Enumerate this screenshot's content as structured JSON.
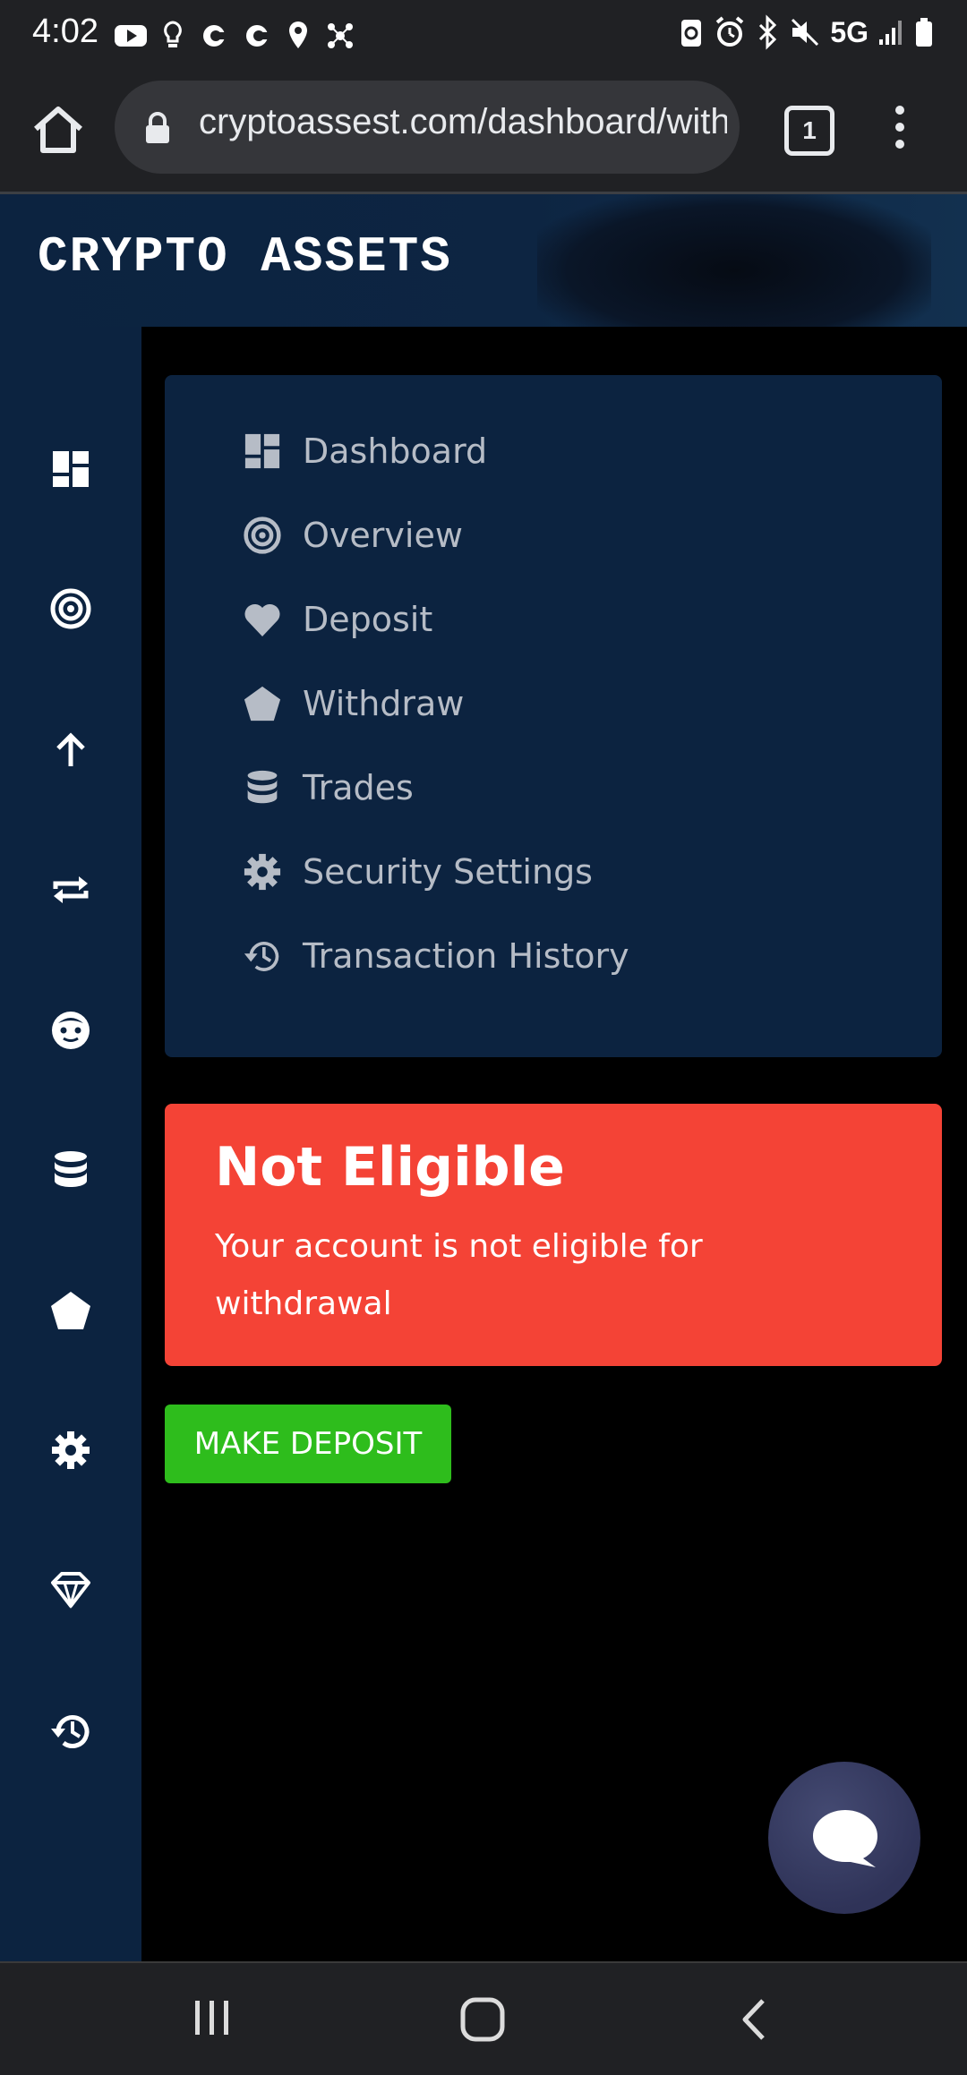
{
  "status_bar": {
    "time": "4:02",
    "network": "5G"
  },
  "browser": {
    "url": "cryptoassest.com/dashboard/withdraw",
    "tab_count": "1"
  },
  "site": {
    "brand": "CRYPTO ASSETS"
  },
  "sidebar": {
    "icons": [
      "dashboard-icon",
      "target-icon",
      "arrow-up-icon",
      "repeat-icon",
      "face-icon",
      "database-icon",
      "pentagon-icon",
      "gear-icon",
      "diamond-icon",
      "history-icon"
    ]
  },
  "menu": {
    "items": [
      {
        "label": "Dashboard",
        "icon": "dashboard-icon"
      },
      {
        "label": "Overview",
        "icon": "target-icon"
      },
      {
        "label": "Deposit",
        "icon": "heart-icon"
      },
      {
        "label": "Withdraw",
        "icon": "pentagon-icon"
      },
      {
        "label": "Trades",
        "icon": "database-icon"
      },
      {
        "label": "Security Settings",
        "icon": "gear-icon"
      },
      {
        "label": "Transaction History",
        "icon": "history-icon"
      }
    ]
  },
  "alert": {
    "title": "Not Eligible",
    "message": "Your account is not eligible for withdrawal",
    "color": "#f44336"
  },
  "deposit_button": {
    "label": "MAKE DEPOSIT",
    "color": "#2ebd1c"
  },
  "colors": {
    "navy": "#0c2340",
    "menu_text": "#b6bcc6"
  }
}
